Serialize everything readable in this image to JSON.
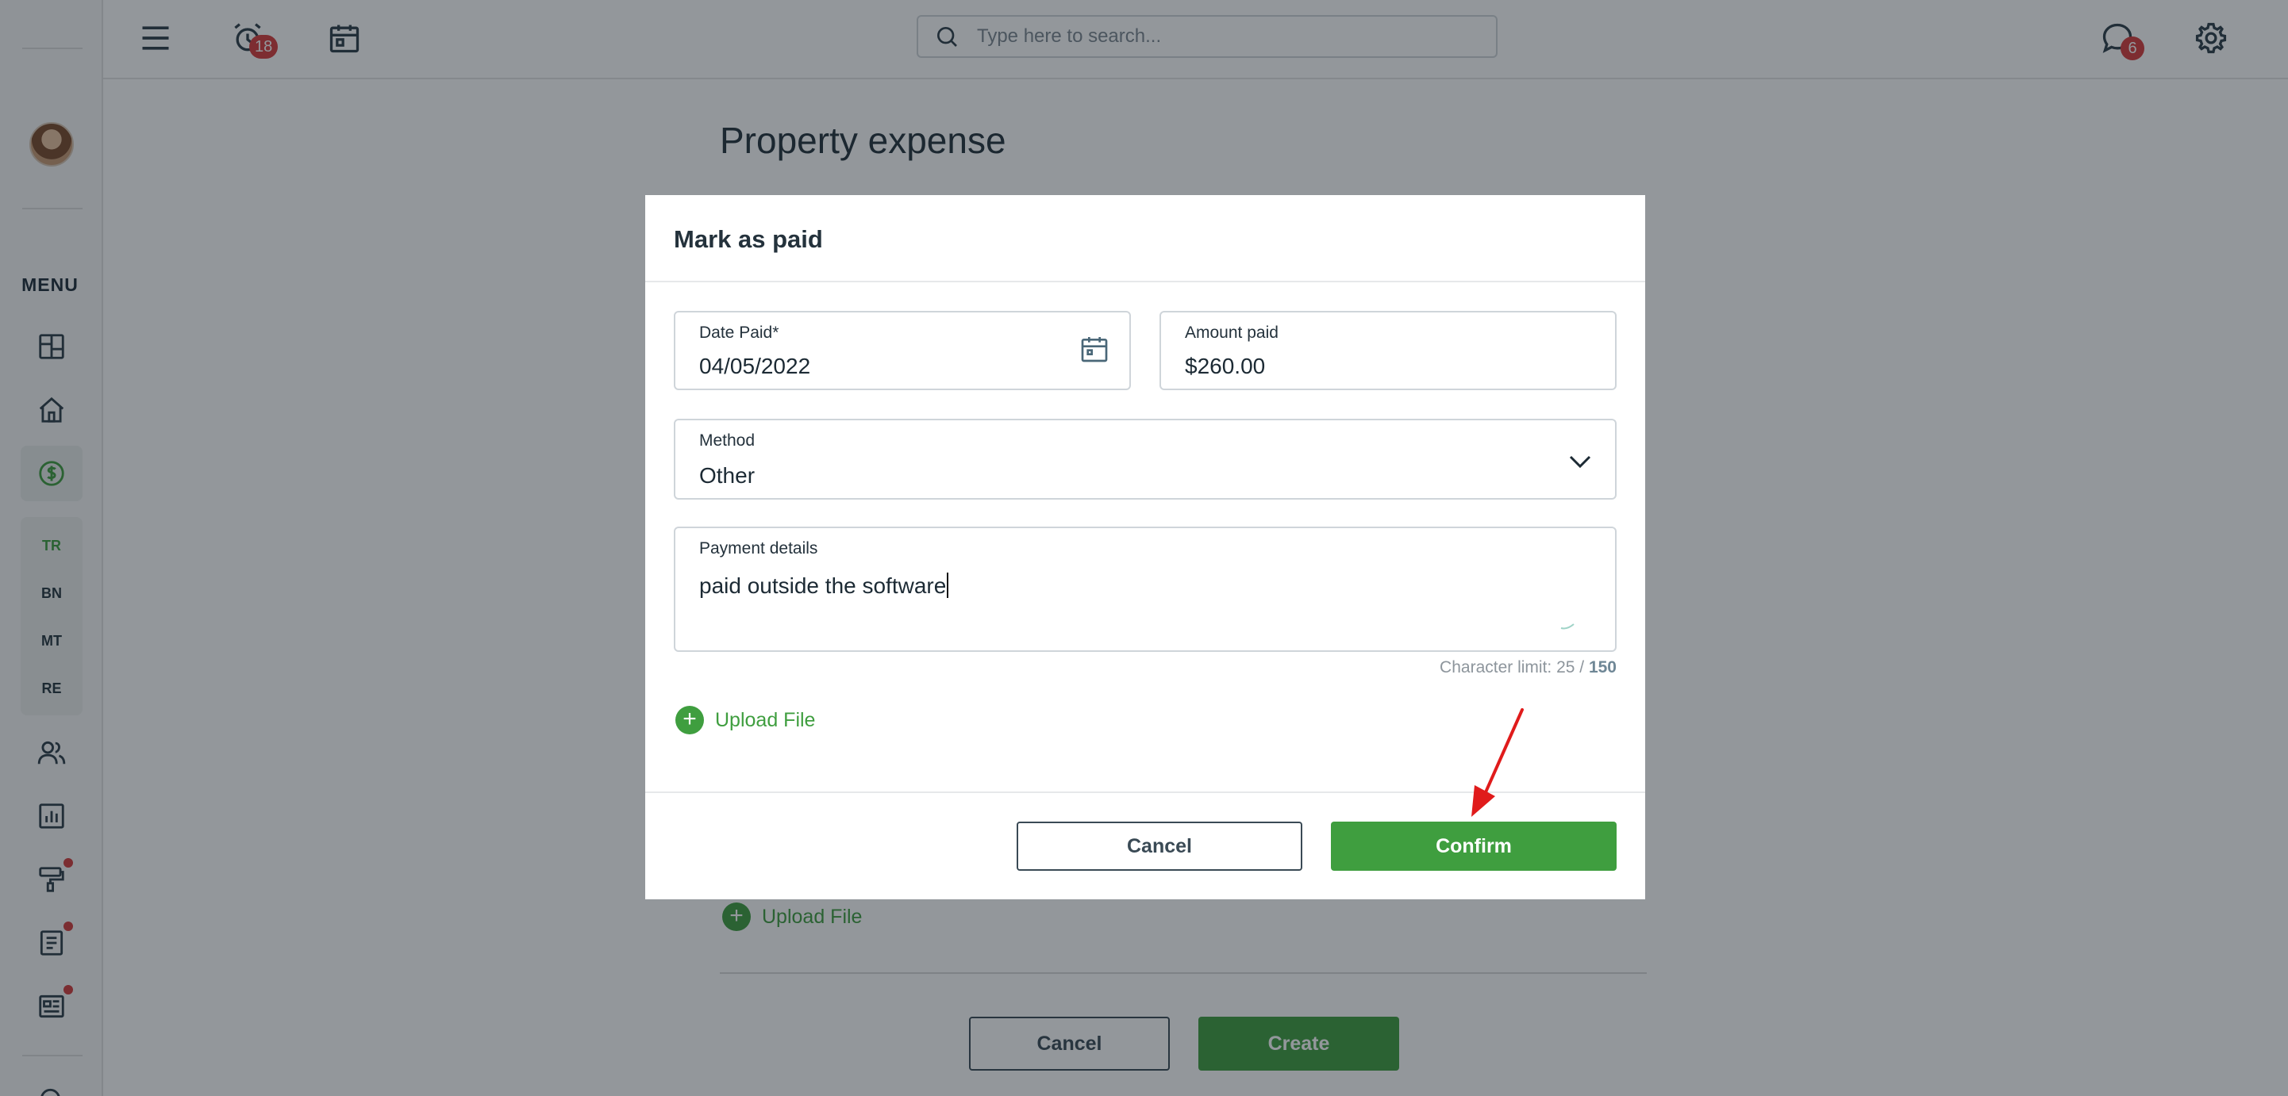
{
  "sidebar": {
    "menu_title": "MENU",
    "sub_items": [
      "TR",
      "BN",
      "MT",
      "RE"
    ],
    "icons": [
      "dashboard-icon",
      "home-icon",
      "dollar-icon",
      "users-icon",
      "chart-icon",
      "maintenance-icon",
      "document-icon",
      "news-icon"
    ]
  },
  "topbar": {
    "notifications_count": "18",
    "messages_count": "6",
    "search_placeholder": "Type here to search..."
  },
  "page": {
    "title": "Property expense",
    "upload_label": "Upload File",
    "cancel_label": "Cancel",
    "create_label": "Create"
  },
  "modal": {
    "title": "Mark as paid",
    "date_label": "Date Paid*",
    "date_value": "04/05/2022",
    "amount_label": "Amount paid",
    "amount_value": "$260.00",
    "method_label": "Method",
    "method_value": "Other",
    "details_label": "Payment details",
    "details_value": "paid outside the software",
    "counter_prefix": "Character limit: 25 / ",
    "counter_max": "150",
    "upload_label": "Upload File",
    "cancel_label": "Cancel",
    "confirm_label": "Confirm"
  },
  "colors": {
    "accent_green": "#3f9e3f",
    "badge_red": "#d63c3c",
    "annotation_arrow": "#e01b1b"
  }
}
